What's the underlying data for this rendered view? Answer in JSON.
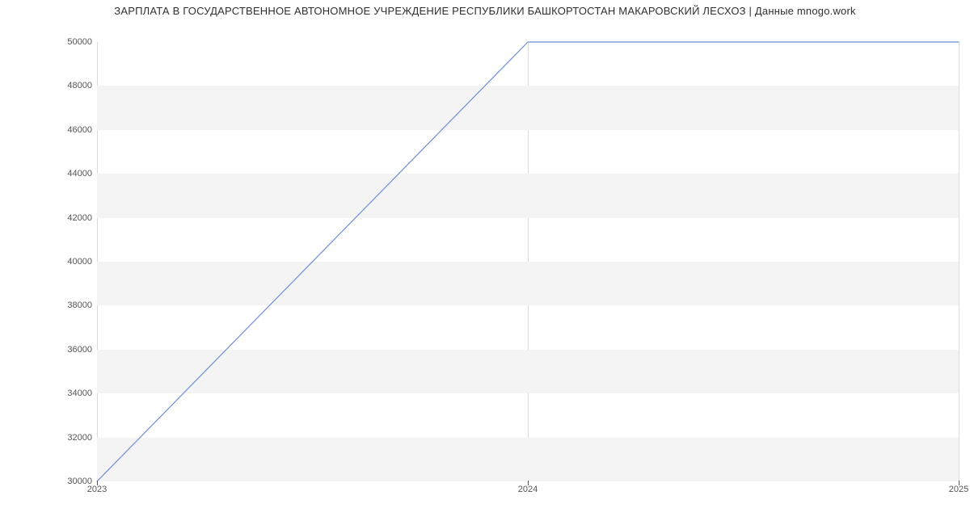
{
  "chart_data": {
    "type": "line",
    "title": "ЗАРПЛАТА В ГОСУДАРСТВЕННОЕ АВТОНОМНОЕ УЧРЕЖДЕНИЕ РЕСПУБЛИКИ БАШКОРТОСТАН    МАКАРОВСКИЙ ЛЕСХОЗ | Данные mnogo.work",
    "x": [
      2023,
      2024,
      2025
    ],
    "series": [
      {
        "name": "salary",
        "values": [
          30000,
          50000,
          50000
        ]
      }
    ],
    "xlabel": "",
    "ylabel": "",
    "y_ticks": [
      30000,
      32000,
      34000,
      36000,
      38000,
      40000,
      42000,
      44000,
      46000,
      48000,
      50000
    ],
    "x_ticks": [
      2023,
      2024,
      2025
    ],
    "ylim": [
      30000,
      50000
    ],
    "xlim": [
      2023,
      2025
    ],
    "grid": {
      "bands": true,
      "xlines": true
    },
    "colors": {
      "line": "#6f8fd9",
      "band": "#f4f4f4"
    }
  }
}
